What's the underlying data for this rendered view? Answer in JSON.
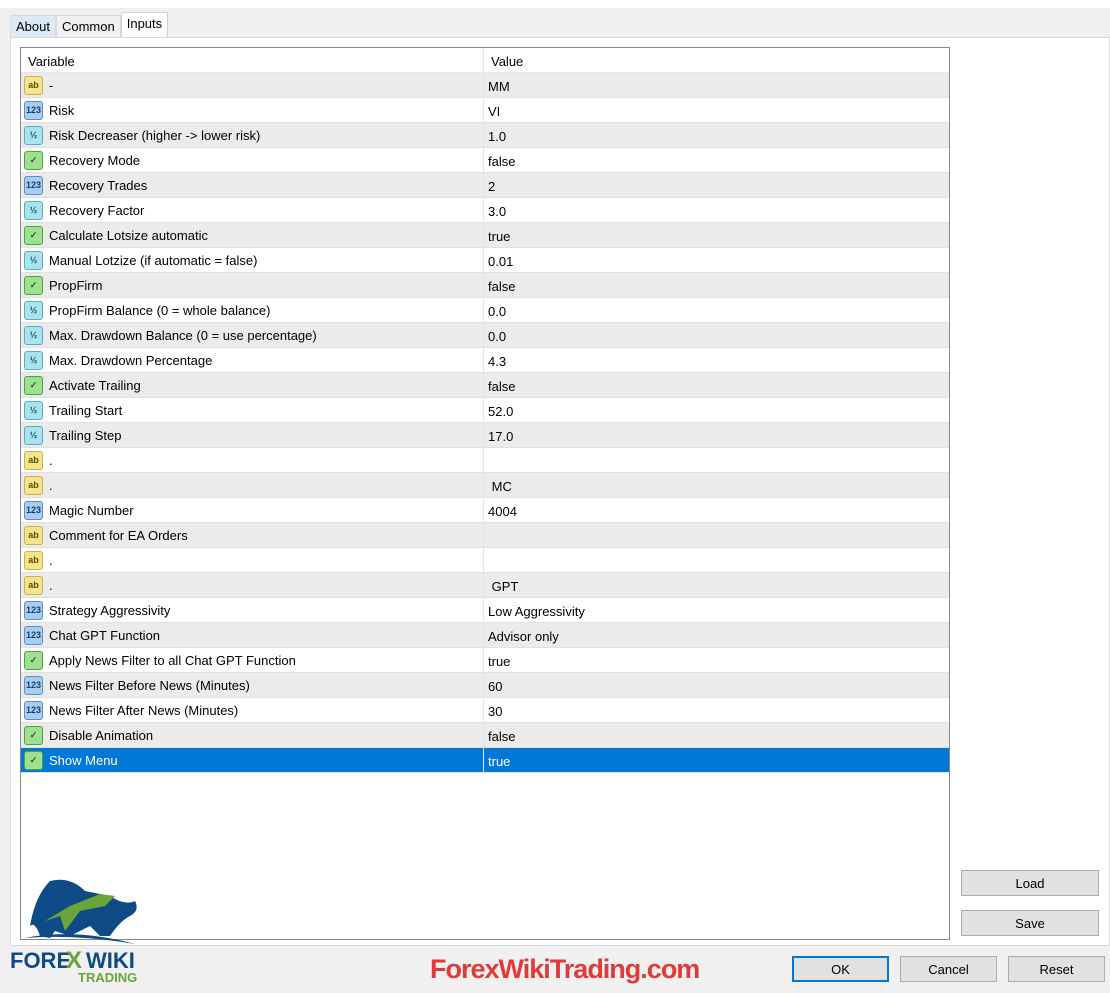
{
  "tabs": [
    "About",
    "Common",
    "Inputs"
  ],
  "columns": {
    "variable": "Variable",
    "value": "Value"
  },
  "rows": [
    {
      "type": "string",
      "icon": "ab",
      "name": "-",
      "value": "MM"
    },
    {
      "type": "int",
      "icon": "123",
      "name": "Risk",
      "value": "VI"
    },
    {
      "type": "double",
      "icon": "½",
      "name": "Risk Decreaser (higher -> lower risk)",
      "value": "1.0"
    },
    {
      "type": "bool",
      "icon": "✓",
      "name": "Recovery Mode",
      "value": "false"
    },
    {
      "type": "int",
      "icon": "123",
      "name": "Recovery Trades",
      "value": "2"
    },
    {
      "type": "double",
      "icon": "½",
      "name": "Recovery Factor",
      "value": "3.0"
    },
    {
      "type": "bool",
      "icon": "✓",
      "name": "Calculate Lotsize automatic",
      "value": "true"
    },
    {
      "type": "double",
      "icon": "½",
      "name": "Manual Lotzize (if automatic = false)",
      "value": "0.01"
    },
    {
      "type": "bool",
      "icon": "✓",
      "name": "PropFirm",
      "value": "false"
    },
    {
      "type": "double",
      "icon": "½",
      "name": "PropFirm Balance (0 = whole balance)",
      "value": "0.0"
    },
    {
      "type": "double",
      "icon": "½",
      "name": "Max. Drawdown Balance (0 = use percentage)",
      "value": "0.0"
    },
    {
      "type": "double",
      "icon": "½",
      "name": "Max. Drawdown Percentage",
      "value": "4.3"
    },
    {
      "type": "bool",
      "icon": "✓",
      "name": "Activate Trailing",
      "value": "false"
    },
    {
      "type": "double",
      "icon": "½",
      "name": "Trailing Start",
      "value": "52.0"
    },
    {
      "type": "double",
      "icon": "½",
      "name": "Trailing Step",
      "value": "17.0"
    },
    {
      "type": "string",
      "icon": "ab",
      "name": ".",
      "value": ""
    },
    {
      "type": "string",
      "icon": "ab",
      "name": ".",
      "value": " MC"
    },
    {
      "type": "int",
      "icon": "123",
      "name": "Magic Number",
      "value": "4004"
    },
    {
      "type": "string",
      "icon": "ab",
      "name": "Comment for EA Orders",
      "value": ""
    },
    {
      "type": "string",
      "icon": "ab",
      "name": ".",
      "value": ""
    },
    {
      "type": "string",
      "icon": "ab",
      "name": ".",
      "value": " GPT"
    },
    {
      "type": "int",
      "icon": "123",
      "name": "Strategy Aggressivity",
      "value": "Low Aggressivity"
    },
    {
      "type": "int",
      "icon": "123",
      "name": "Chat GPT Function",
      "value": "Advisor only"
    },
    {
      "type": "bool",
      "icon": "✓",
      "name": "Apply News Filter to all Chat GPT Function",
      "value": "true"
    },
    {
      "type": "int",
      "icon": "123",
      "name": "News Filter Before News (Minutes)",
      "value": "60"
    },
    {
      "type": "int",
      "icon": "123",
      "name": "News Filter After News (Minutes)",
      "value": "30"
    },
    {
      "type": "bool",
      "icon": "✓",
      "name": "Disable Animation",
      "value": "false"
    },
    {
      "type": "bool",
      "icon": "✓",
      "name": "Show Menu",
      "value": "true",
      "selected": true
    }
  ],
  "buttons": {
    "load": "Load",
    "save": "Save",
    "ok": "OK",
    "cancel": "Cancel",
    "reset": "Reset"
  },
  "watermark": "ForexWikiTrading.com",
  "logo": {
    "line1": "FOREX WIKI",
    "line2": "TRADING"
  }
}
